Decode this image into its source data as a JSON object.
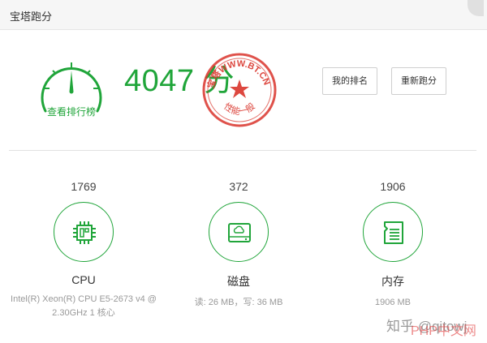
{
  "window": {
    "title": "宝塔跑分"
  },
  "gauge": {
    "link_label": "查看排行榜"
  },
  "score": {
    "value": "4047",
    "unit": "分"
  },
  "stamp": {
    "text_top": "宝塔WWW.BT.CN",
    "text_bottom": "性能一般",
    "color": "#d9342b"
  },
  "buttons": {
    "rank": "我的排名",
    "rerun": "重新跑分"
  },
  "items": [
    {
      "value": "1769",
      "name": "CPU",
      "detail": "Intel(R) Xeon(R) CPU E5-2673 v4 @ 2.30GHz 1 核心"
    },
    {
      "value": "372",
      "name": "磁盘",
      "detail": "读: 26 MB，写: 36 MB"
    },
    {
      "value": "1906",
      "name": "内存",
      "detail": "1906 MB"
    }
  ],
  "watermark": {
    "text": "知乎 @qitowj",
    "overlay": "PHP中文网"
  },
  "colors": {
    "accent": "#20a53a"
  }
}
